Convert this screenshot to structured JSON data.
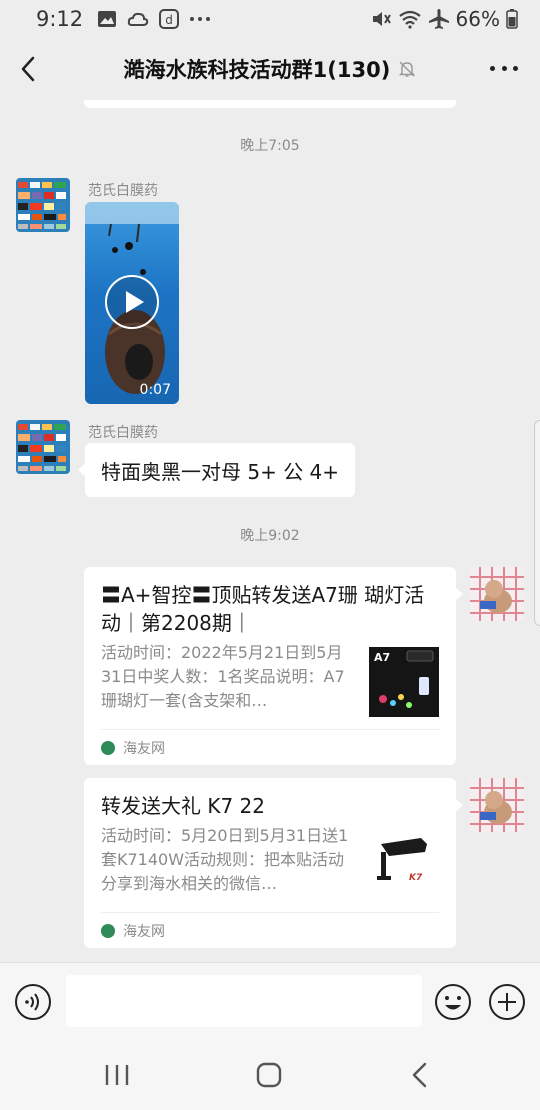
{
  "status_bar": {
    "time": "9:12",
    "battery_percent": "66%",
    "left_icons": [
      "image-icon",
      "cloud-icon",
      "d-app-icon",
      "more-dots-icon"
    ],
    "right_icons": [
      "mute-vibrate-icon",
      "wifi-icon",
      "airplane-icon",
      "battery-icon"
    ]
  },
  "header": {
    "title": "澔海水族科技活动群1(130)",
    "icons": [
      "back-icon",
      "mute-bell-icon",
      "more-icon"
    ]
  },
  "messages": {
    "time_1": "晚上7:05",
    "video_sender": "范氏白膜药",
    "video_duration": "0:07",
    "text_sender": "范氏白膜药",
    "text_content": "特面奥黑一对母 5+ 公 4+",
    "time_2": "晚上9:02",
    "card_1": {
      "title": "〓A+智控〓顶贴转发送A7珊 瑚灯活动｜第2208期｜",
      "description": "活动时间：2022年5月21日到5月31日中奖人数：1名奖品说明：A7珊瑚灯一套(含支架和…",
      "thumb_label": "A7",
      "source": "海友网"
    },
    "card_2": {
      "title": "转发送大礼 K7 22",
      "description": "活动时间：5月20日到5月31日送1套K7140W活动规则：把本贴活动分享到海水相关的微信…",
      "thumb_label": "K7",
      "source": "海友网"
    }
  },
  "input_bar": {
    "placeholder": "",
    "icons": [
      "voice-icon",
      "emoji-icon",
      "plus-icon"
    ]
  },
  "nav_bar": {
    "icons": [
      "recents-icon",
      "home-icon",
      "back-nav-icon"
    ]
  },
  "colors": {
    "background": "#ededed",
    "bubble": "#ffffff",
    "secondary_text": "#8a8a8a",
    "video_blue": "#1d74c4"
  }
}
